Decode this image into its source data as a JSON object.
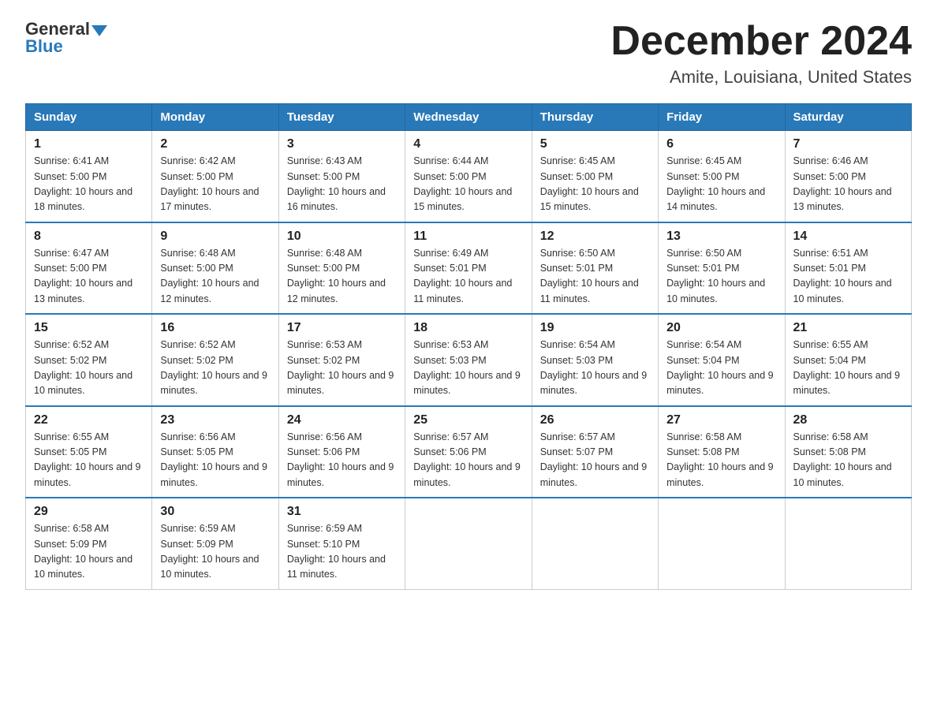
{
  "logo": {
    "general": "General",
    "blue": "Blue"
  },
  "title": {
    "month": "December 2024",
    "location": "Amite, Louisiana, United States"
  },
  "headers": [
    "Sunday",
    "Monday",
    "Tuesday",
    "Wednesday",
    "Thursday",
    "Friday",
    "Saturday"
  ],
  "weeks": [
    [
      {
        "day": "1",
        "sunrise": "6:41 AM",
        "sunset": "5:00 PM",
        "daylight": "10 hours and 18 minutes."
      },
      {
        "day": "2",
        "sunrise": "6:42 AM",
        "sunset": "5:00 PM",
        "daylight": "10 hours and 17 minutes."
      },
      {
        "day": "3",
        "sunrise": "6:43 AM",
        "sunset": "5:00 PM",
        "daylight": "10 hours and 16 minutes."
      },
      {
        "day": "4",
        "sunrise": "6:44 AM",
        "sunset": "5:00 PM",
        "daylight": "10 hours and 15 minutes."
      },
      {
        "day": "5",
        "sunrise": "6:45 AM",
        "sunset": "5:00 PM",
        "daylight": "10 hours and 15 minutes."
      },
      {
        "day": "6",
        "sunrise": "6:45 AM",
        "sunset": "5:00 PM",
        "daylight": "10 hours and 14 minutes."
      },
      {
        "day": "7",
        "sunrise": "6:46 AM",
        "sunset": "5:00 PM",
        "daylight": "10 hours and 13 minutes."
      }
    ],
    [
      {
        "day": "8",
        "sunrise": "6:47 AM",
        "sunset": "5:00 PM",
        "daylight": "10 hours and 13 minutes."
      },
      {
        "day": "9",
        "sunrise": "6:48 AM",
        "sunset": "5:00 PM",
        "daylight": "10 hours and 12 minutes."
      },
      {
        "day": "10",
        "sunrise": "6:48 AM",
        "sunset": "5:00 PM",
        "daylight": "10 hours and 12 minutes."
      },
      {
        "day": "11",
        "sunrise": "6:49 AM",
        "sunset": "5:01 PM",
        "daylight": "10 hours and 11 minutes."
      },
      {
        "day": "12",
        "sunrise": "6:50 AM",
        "sunset": "5:01 PM",
        "daylight": "10 hours and 11 minutes."
      },
      {
        "day": "13",
        "sunrise": "6:50 AM",
        "sunset": "5:01 PM",
        "daylight": "10 hours and 10 minutes."
      },
      {
        "day": "14",
        "sunrise": "6:51 AM",
        "sunset": "5:01 PM",
        "daylight": "10 hours and 10 minutes."
      }
    ],
    [
      {
        "day": "15",
        "sunrise": "6:52 AM",
        "sunset": "5:02 PM",
        "daylight": "10 hours and 10 minutes."
      },
      {
        "day": "16",
        "sunrise": "6:52 AM",
        "sunset": "5:02 PM",
        "daylight": "10 hours and 9 minutes."
      },
      {
        "day": "17",
        "sunrise": "6:53 AM",
        "sunset": "5:02 PM",
        "daylight": "10 hours and 9 minutes."
      },
      {
        "day": "18",
        "sunrise": "6:53 AM",
        "sunset": "5:03 PM",
        "daylight": "10 hours and 9 minutes."
      },
      {
        "day": "19",
        "sunrise": "6:54 AM",
        "sunset": "5:03 PM",
        "daylight": "10 hours and 9 minutes."
      },
      {
        "day": "20",
        "sunrise": "6:54 AM",
        "sunset": "5:04 PM",
        "daylight": "10 hours and 9 minutes."
      },
      {
        "day": "21",
        "sunrise": "6:55 AM",
        "sunset": "5:04 PM",
        "daylight": "10 hours and 9 minutes."
      }
    ],
    [
      {
        "day": "22",
        "sunrise": "6:55 AM",
        "sunset": "5:05 PM",
        "daylight": "10 hours and 9 minutes."
      },
      {
        "day": "23",
        "sunrise": "6:56 AM",
        "sunset": "5:05 PM",
        "daylight": "10 hours and 9 minutes."
      },
      {
        "day": "24",
        "sunrise": "6:56 AM",
        "sunset": "5:06 PM",
        "daylight": "10 hours and 9 minutes."
      },
      {
        "day": "25",
        "sunrise": "6:57 AM",
        "sunset": "5:06 PM",
        "daylight": "10 hours and 9 minutes."
      },
      {
        "day": "26",
        "sunrise": "6:57 AM",
        "sunset": "5:07 PM",
        "daylight": "10 hours and 9 minutes."
      },
      {
        "day": "27",
        "sunrise": "6:58 AM",
        "sunset": "5:08 PM",
        "daylight": "10 hours and 9 minutes."
      },
      {
        "day": "28",
        "sunrise": "6:58 AM",
        "sunset": "5:08 PM",
        "daylight": "10 hours and 10 minutes."
      }
    ],
    [
      {
        "day": "29",
        "sunrise": "6:58 AM",
        "sunset": "5:09 PM",
        "daylight": "10 hours and 10 minutes."
      },
      {
        "day": "30",
        "sunrise": "6:59 AM",
        "sunset": "5:09 PM",
        "daylight": "10 hours and 10 minutes."
      },
      {
        "day": "31",
        "sunrise": "6:59 AM",
        "sunset": "5:10 PM",
        "daylight": "10 hours and 11 minutes."
      },
      null,
      null,
      null,
      null
    ]
  ]
}
